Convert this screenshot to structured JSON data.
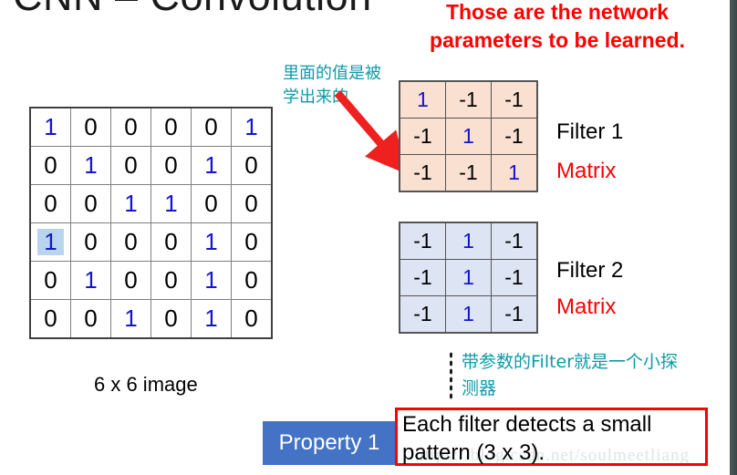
{
  "slide": {
    "title": "CNN – Convolution",
    "headline_lines": [
      "Those are the network",
      "parameters to be learned."
    ],
    "headline_color": "#ff0000",
    "accent_teal": "#0e9aa7",
    "accent_blue": "#1414d2",
    "badge_color": "#4472c4"
  },
  "annotations": {
    "note_near_arrow": [
      "里面的值是被",
      "学出来的"
    ],
    "note_bottom": [
      "带参数的Filter就是一个小探",
      "测器"
    ]
  },
  "input_image": {
    "caption": "6 x 6 image",
    "rows": [
      [
        "1",
        "0",
        "0",
        "0",
        "0",
        "1"
      ],
      [
        "0",
        "1",
        "0",
        "0",
        "1",
        "0"
      ],
      [
        "0",
        "0",
        "1",
        "1",
        "0",
        "0"
      ],
      [
        "1",
        "0",
        "0",
        "0",
        "1",
        "0"
      ],
      [
        "0",
        "1",
        "0",
        "0",
        "1",
        "0"
      ],
      [
        "0",
        "0",
        "1",
        "0",
        "1",
        "0"
      ]
    ],
    "selected_cell": {
      "row": 3,
      "col": 0,
      "highlight_color": "#b9d4ee"
    }
  },
  "filters": [
    {
      "label": "Filter 1",
      "sublabel": "Matrix",
      "fill": "#fae0d0",
      "rows": [
        [
          "1",
          "-1",
          "-1"
        ],
        [
          "-1",
          "1",
          "-1"
        ],
        [
          "-1",
          "-1",
          "1"
        ]
      ]
    },
    {
      "label": "Filter 2",
      "sublabel": "Matrix",
      "fill": "#dde4f3",
      "rows": [
        [
          "-1",
          "1",
          "-1"
        ],
        [
          "-1",
          "1",
          "-1"
        ],
        [
          "-1",
          "1",
          "-1"
        ]
      ]
    }
  ],
  "property": {
    "badge": "Property 1",
    "text_lines": [
      "Each filter detects a small",
      "pattern (3 x 3)."
    ],
    "box_border_color": "#ff0000"
  },
  "watermark": "https://blog.csdn.net/soulmeetliang"
}
